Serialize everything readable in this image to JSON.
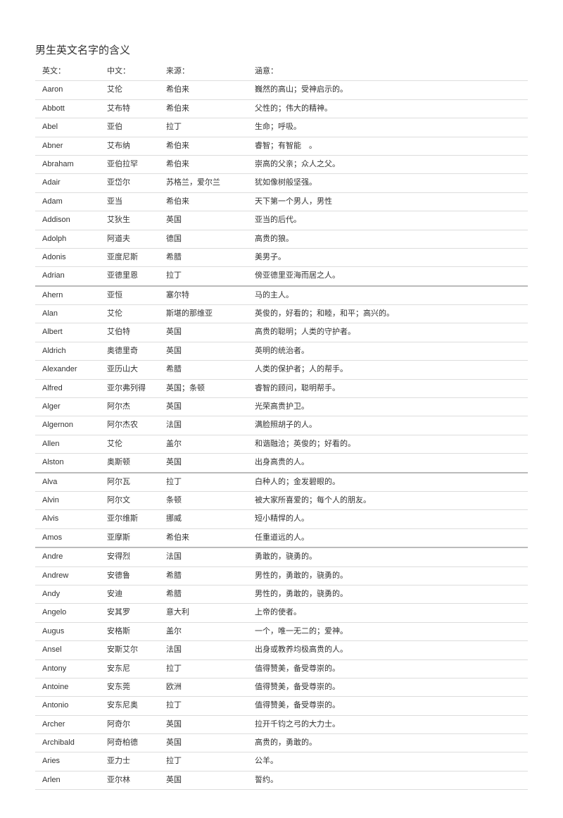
{
  "title": "男生英文名字的含义",
  "headers": {
    "english": "英文：",
    "chinese": "中文：",
    "origin": "来源：",
    "meaning": "涵意："
  },
  "rows": [
    {
      "en": "Aaron",
      "cn": "艾伦",
      "origin": "希伯来",
      "meaning": "巍然的高山；受神启示的。",
      "thick": false
    },
    {
      "en": "Abbott",
      "cn": "艾布特",
      "origin": "希伯来",
      "meaning": "父性的；伟大的精神。",
      "thick": false
    },
    {
      "en": "Abel",
      "cn": "亚伯",
      "origin": "拉丁",
      "meaning": "生命；呼吸。",
      "thick": false
    },
    {
      "en": "Abner",
      "cn": "艾布纳",
      "origin": "希伯来",
      "meaning": "睿智；有智能　。",
      "thick": false
    },
    {
      "en": "Abraham",
      "cn": "亚伯拉罕",
      "origin": "希伯来",
      "meaning": "崇高的父亲；众人之父。",
      "thick": false
    },
    {
      "en": "Adair",
      "cn": "亚岱尔",
      "origin": "苏格兰，爱尔兰",
      "meaning": "犹如像树般坚强。",
      "thick": false
    },
    {
      "en": "Adam",
      "cn": "亚当",
      "origin": "希伯来",
      "meaning": "天下第一个男人，男性",
      "thick": false
    },
    {
      "en": "Addison",
      "cn": "艾狄生",
      "origin": "英国",
      "meaning": "亚当的后代。",
      "thick": false
    },
    {
      "en": "Adolph",
      "cn": "阿道夫",
      "origin": "德国",
      "meaning": "高贵的狼。",
      "thick": false
    },
    {
      "en": "Adonis",
      "cn": "亚度尼斯",
      "origin": "希腊",
      "meaning": "美男子。",
      "thick": false
    },
    {
      "en": "Adrian",
      "cn": "亚德里恩",
      "origin": "拉丁",
      "meaning": "傍亚德里亚海而居之人。",
      "thick": true
    },
    {
      "en": "Ahern",
      "cn": "亚恒",
      "origin": "塞尔特",
      "meaning": "马的主人。",
      "thick": false
    },
    {
      "en": "Alan",
      "cn": "艾伦",
      "origin": "斯堪的那维亚",
      "meaning": "英俊的，好看的；和睦，和平；高兴的。",
      "thick": false
    },
    {
      "en": "Albert",
      "cn": "艾伯特",
      "origin": "英国",
      "meaning": "高贵的聪明；人类的守护者。",
      "thick": false
    },
    {
      "en": "Aldrich",
      "cn": "奥德里奇",
      "origin": "英国",
      "meaning": "英明的统治者。",
      "thick": false
    },
    {
      "en": "Alexander",
      "cn": "亚历山大",
      "origin": "希腊",
      "meaning": "人类的保护者；人的帮手。",
      "thick": false
    },
    {
      "en": "Alfred",
      "cn": "亚尔弗列得",
      "origin": "英国；条顿",
      "meaning": "睿智的顾问，聪明帮手。",
      "thick": false
    },
    {
      "en": "Alger",
      "cn": "阿尔杰",
      "origin": "英国",
      "meaning": "光荣高贵护卫。",
      "thick": false
    },
    {
      "en": "Algernon",
      "cn": "阿尔杰农",
      "origin": "法国",
      "meaning": "满脸照胡子的人。",
      "thick": false
    },
    {
      "en": "Allen",
      "cn": "艾伦",
      "origin": "盖尔",
      "meaning": "和谐融洽；英俊的；好看的。",
      "thick": false
    },
    {
      "en": "Alston",
      "cn": "奥斯顿",
      "origin": "英国",
      "meaning": "出身高贵的人。",
      "thick": true
    },
    {
      "en": "Alva",
      "cn": "阿尔瓦",
      "origin": "拉丁",
      "meaning": "白种人的；金发碧眼的。",
      "thick": false
    },
    {
      "en": "Alvin",
      "cn": "阿尔文",
      "origin": "条顿",
      "meaning": "被大家所喜爱的；每个人的朋友。",
      "thick": false
    },
    {
      "en": "Alvis",
      "cn": "亚尔维斯",
      "origin": "挪威",
      "meaning": "短小精悍的人。",
      "thick": false
    },
    {
      "en": "Amos",
      "cn": "亚摩斯",
      "origin": "希伯来",
      "meaning": "任重道远的人。",
      "thick": true
    },
    {
      "en": "Andre",
      "cn": "安得烈",
      "origin": "法国",
      "meaning": "勇敢的，骁勇的。",
      "thick": false
    },
    {
      "en": "Andrew",
      "cn": "安德鲁",
      "origin": "希腊",
      "meaning": "男性的，勇敢的，骁勇的。",
      "thick": false
    },
    {
      "en": "Andy",
      "cn": "安迪",
      "origin": "希腊",
      "meaning": "男性的，勇敢的，骁勇的。",
      "thick": false
    },
    {
      "en": "Angelo",
      "cn": "安其罗",
      "origin": "意大利",
      "meaning": "上帝的使者。",
      "thick": false
    },
    {
      "en": "Augus",
      "cn": "安格斯",
      "origin": "盖尔",
      "meaning": "一个，唯一无二的；爱神。",
      "thick": false
    },
    {
      "en": "Ansel",
      "cn": "安斯艾尔",
      "origin": "法国",
      "meaning": "出身或教养均极高贵的人。",
      "thick": false
    },
    {
      "en": "Antony",
      "cn": "安东尼",
      "origin": "拉丁",
      "meaning": "值得赞美，备受尊崇的。",
      "thick": false
    },
    {
      "en": "Antoine",
      "cn": "安东莞",
      "origin": "欧洲",
      "meaning": "值得赞美，备受尊崇的。",
      "thick": false
    },
    {
      "en": "Antonio",
      "cn": "安东尼奥",
      "origin": "拉丁",
      "meaning": "值得赞美，备受尊崇的。",
      "thick": false
    },
    {
      "en": "Archer",
      "cn": "阿奇尔",
      "origin": "英国",
      "meaning": "拉开千钧之弓的大力士。",
      "thick": false
    },
    {
      "en": "Archibald",
      "cn": "阿奇柏德",
      "origin": "英国",
      "meaning": "高贵的，勇敢的。",
      "thick": false
    },
    {
      "en": "Aries",
      "cn": "亚力士",
      "origin": "拉丁",
      "meaning": "公羊。",
      "thick": false
    },
    {
      "en": "Arlen",
      "cn": "亚尔林",
      "origin": "英国",
      "meaning": "誓约。",
      "thick": false
    }
  ]
}
